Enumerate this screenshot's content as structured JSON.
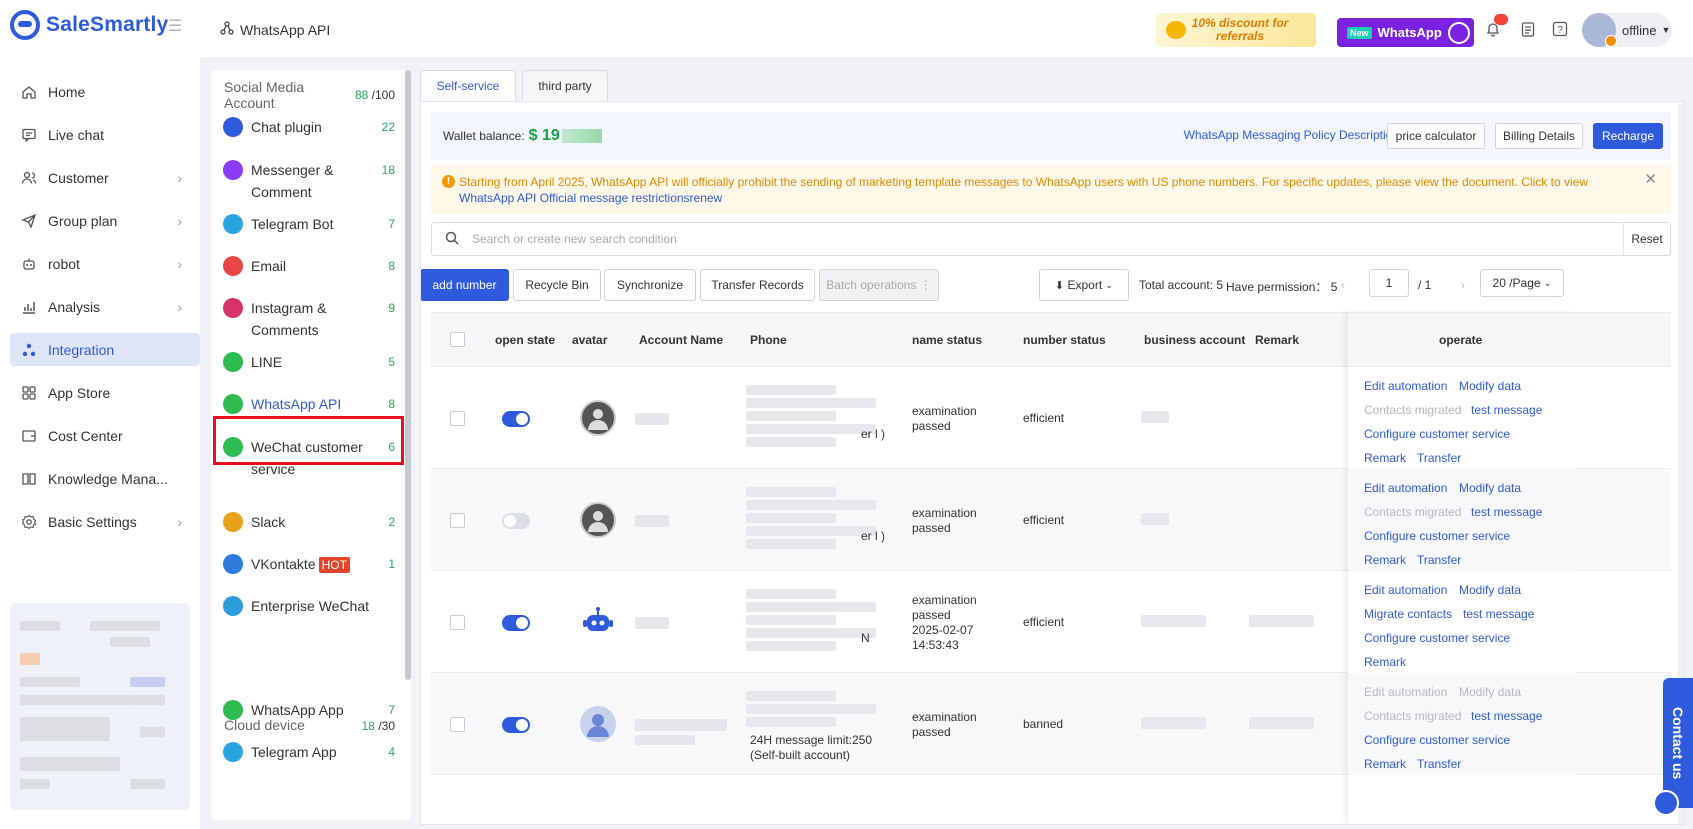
{
  "brand": {
    "name": "SaleSmartly"
  },
  "sidebar": {
    "items": [
      {
        "label": "Home",
        "icon": "home-icon",
        "chevron": false,
        "active": false
      },
      {
        "label": "Live chat",
        "icon": "chat-icon",
        "chevron": false,
        "active": false
      },
      {
        "label": "Customer",
        "icon": "users-icon",
        "chevron": true,
        "active": false
      },
      {
        "label": "Group plan",
        "icon": "send-icon",
        "chevron": true,
        "active": false
      },
      {
        "label": "robot",
        "icon": "robot-icon",
        "chevron": true,
        "active": false
      },
      {
        "label": "Analysis",
        "icon": "chart-icon",
        "chevron": true,
        "active": false
      },
      {
        "label": "Integration",
        "icon": "integration-icon",
        "chevron": false,
        "active": true
      },
      {
        "label": "App Store",
        "icon": "apps-icon",
        "chevron": false,
        "active": false
      },
      {
        "label": "Cost Center",
        "icon": "wallet-icon",
        "chevron": false,
        "active": false
      },
      {
        "label": "Knowledge Mana...",
        "icon": "book-icon",
        "chevron": false,
        "active": false
      },
      {
        "label": "Basic Settings",
        "icon": "gear-icon",
        "chevron": true,
        "active": false
      }
    ]
  },
  "topbar": {
    "breadcrumb": "WhatsApp API",
    "promo_discount": "10% discount for referrals",
    "promo_whatsapp_badge": "New",
    "promo_whatsapp": "WhatsApp",
    "status": "offline"
  },
  "subpanel": {
    "social_header": "Social Media Account",
    "social_used": "88",
    "social_total": "/100",
    "items": [
      {
        "label": "Chat plugin",
        "count": "22",
        "color": "#2e5bdc",
        "icon": "chat-plugin-icon"
      },
      {
        "label": "Messenger & Comment",
        "count": "18",
        "color": "#8b3cf7",
        "icon": "messenger-icon"
      },
      {
        "label": "Telegram Bot",
        "count": "7",
        "color": "#2aa3e0",
        "icon": "telegram-icon"
      },
      {
        "label": "Email",
        "count": "8",
        "color": "#e84545",
        "icon": "email-icon"
      },
      {
        "label": "Instagram & Comments",
        "count": "9",
        "color": "#d6336c",
        "icon": "instagram-icon"
      },
      {
        "label": "LINE",
        "count": "5",
        "color": "#2ebc52",
        "icon": "line-icon"
      },
      {
        "label": "WhatsApp API",
        "count": "8",
        "color": "#2ebc52",
        "icon": "whatsapp-icon"
      },
      {
        "label": "WeChat customer service",
        "count": "6",
        "color": "#2ebc52",
        "icon": "wechat-icon"
      },
      {
        "label": "Slack",
        "count": "2",
        "color": "#e8a21a",
        "icon": "slack-icon"
      },
      {
        "label": "VKontakte",
        "count": "1",
        "color": "#2e7bdc",
        "icon": "vk-icon",
        "hot": "HOT"
      },
      {
        "label": "Enterprise WeChat",
        "count": "",
        "color": "#2e9bdc",
        "icon": "enterprise-wechat-icon"
      }
    ],
    "cloud_header": "Cloud device",
    "cloud_used": "18",
    "cloud_total": "/30",
    "cloud_items": [
      {
        "label": "WhatsApp App",
        "count": "7",
        "color": "#2ebc52",
        "icon": "whatsapp-app-icon"
      },
      {
        "label": "Telegram App",
        "count": "4",
        "color": "#2aa3e0",
        "icon": "telegram-app-icon"
      }
    ]
  },
  "main": {
    "tabs": [
      "Self-service",
      "third party"
    ],
    "wallet_label": "Wallet balance:",
    "wallet_amount": "$ 19",
    "policy_link": "WhatsApp Messaging Policy Description",
    "price_calculator": "price calculator",
    "billing_details": "Billing Details",
    "recharge": "Recharge",
    "notice_text": "Starting from April 2025, WhatsApp API will officially prohibit the sending of marketing template messages to WhatsApp users with US phone numbers. For specific updates, please view the document. Click to view",
    "notice_link": "WhatsApp API Official message restrictionsrenew",
    "search_placeholder": "Search or create new search condition",
    "reset": "Reset",
    "add_number": "add number",
    "recycle_bin": "Recycle Bin",
    "synchronize": "Synchronize",
    "transfer_records": "Transfer Records",
    "batch_operations": "Batch operations",
    "export": "Export",
    "total_account": "Total account: 5",
    "have_permission": "Have permission： 5",
    "page_current": "1",
    "page_total": "/ 1",
    "page_size": "20 /Page"
  },
  "table": {
    "headers": [
      "open state",
      "avatar",
      "Account Name",
      "Phone",
      "name status",
      "number status",
      "business account",
      "Remark",
      "operate"
    ],
    "rows": [
      {
        "enabled": true,
        "avatar": "dark",
        "phone_suffix": "er l )",
        "phone_extra": "",
        "name_status": "examination passed",
        "name_status_date": "",
        "number_status": "efficient",
        "ops": [
          [
            "Edit automation",
            false
          ],
          [
            "Modify data",
            false
          ],
          [
            "Contacts migrated",
            true
          ],
          [
            "test message",
            false
          ],
          [
            "Configure customer service",
            false
          ],
          [
            "Remark",
            false
          ],
          [
            "Transfer",
            false
          ]
        ]
      },
      {
        "enabled": false,
        "avatar": "dark",
        "phone_suffix": "er l )",
        "phone_extra": "",
        "name_status": "examination passed",
        "name_status_date": "",
        "number_status": "efficient",
        "ops": [
          [
            "Edit automation",
            false
          ],
          [
            "Modify data",
            false
          ],
          [
            "Contacts migrated",
            true
          ],
          [
            "test message",
            false
          ],
          [
            "Configure customer service",
            false
          ],
          [
            "Remark",
            false
          ],
          [
            "Transfer",
            false
          ]
        ]
      },
      {
        "enabled": true,
        "avatar": "robot",
        "phone_suffix": "N",
        "phone_extra": "",
        "name_status": "examination passed",
        "name_status_date": "2025-02-07 14:53:43",
        "number_status": "efficient",
        "ops": [
          [
            "Edit automation",
            false
          ],
          [
            "Modify data",
            false
          ],
          [
            "Migrate contacts",
            false
          ],
          [
            "test message",
            false
          ],
          [
            "Configure customer service",
            false
          ],
          [
            "Remark",
            false
          ]
        ]
      },
      {
        "enabled": true,
        "avatar": "person",
        "phone_suffix": "",
        "phone_extra": "24H message limit:250 (Self-built account)",
        "name_status": "examination passed",
        "name_status_date": "",
        "number_status": "banned",
        "ops": [
          [
            "Edit automation",
            true
          ],
          [
            "Modify data",
            true
          ],
          [
            "Contacts migrated",
            true
          ],
          [
            "test message",
            false
          ],
          [
            "Configure customer service",
            false
          ],
          [
            "Remark",
            false
          ],
          [
            "Transfer",
            false
          ]
        ]
      }
    ]
  },
  "contact_us": "Contact us",
  "colors": {
    "accent": "#2e5bdc",
    "success": "#16a34a",
    "warning": "#e08b00",
    "danger": "#e6101d"
  }
}
